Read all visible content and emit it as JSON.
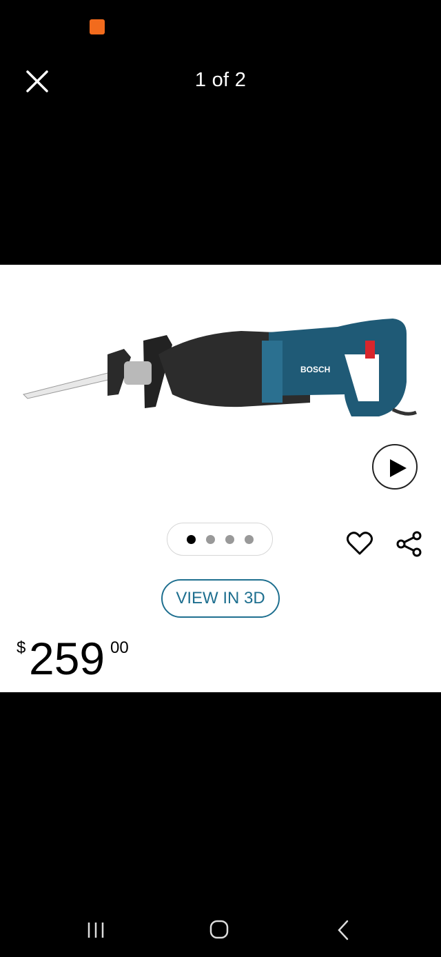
{
  "viewer": {
    "counter": "1 of 2"
  },
  "product": {
    "price": {
      "currency": "$",
      "dollars": "259",
      "cents": "00"
    },
    "view_3d_label": "VIEW IN 3D",
    "brand_text": "BOSCH",
    "image_count_dots": 4,
    "active_dot": 1
  },
  "icons": {
    "close": "close-icon",
    "play": "play-icon",
    "favorite": "heart-icon",
    "share": "share-icon",
    "nav_recents": "recents-icon",
    "nav_home": "home-icon",
    "nav_back": "back-icon"
  },
  "colors": {
    "accent": "#1e6f8f",
    "tool_body": "#1f5a76",
    "panel_bg": "#ffffff",
    "page_bg": "#000000"
  }
}
